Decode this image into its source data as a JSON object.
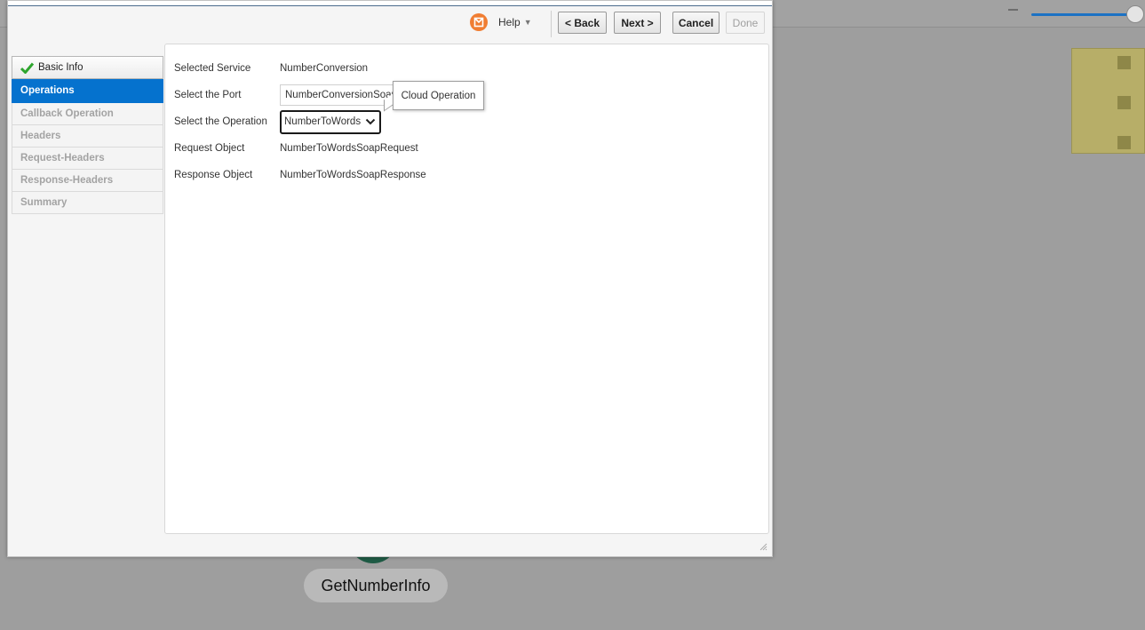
{
  "canvas": {
    "node_label": "GetNumberInfo"
  },
  "toolbar": {
    "help_label": "Help",
    "back_label": "< Back",
    "next_label": "Next >",
    "cancel_label": "Cancel",
    "done_label": "Done"
  },
  "train": {
    "steps": [
      {
        "label": "Basic Info",
        "state": "completed"
      },
      {
        "label": "Operations",
        "state": "active"
      },
      {
        "label": "Callback Operation",
        "state": "disabled"
      },
      {
        "label": "Headers",
        "state": "disabled"
      },
      {
        "label": "Request-Headers",
        "state": "disabled"
      },
      {
        "label": "Response-Headers",
        "state": "disabled"
      },
      {
        "label": "Summary",
        "state": "disabled"
      }
    ]
  },
  "form": {
    "selected_service": {
      "label": "Selected Service",
      "value": "NumberConversion"
    },
    "port": {
      "label": "Select the Port",
      "value": "NumberConversionSoap"
    },
    "operation": {
      "label": "Select the Operation",
      "value": "NumberToWords"
    },
    "request_object": {
      "label": "Request Object",
      "value": "NumberToWordsSoapRequest"
    },
    "response_object": {
      "label": "Response Object",
      "value": "NumberToWordsSoapResponse"
    }
  },
  "tooltip": {
    "text": "Cloud Operation"
  },
  "colors": {
    "accent": "#0572ce",
    "check": "#2ea52e",
    "flag": "#f07d32"
  }
}
